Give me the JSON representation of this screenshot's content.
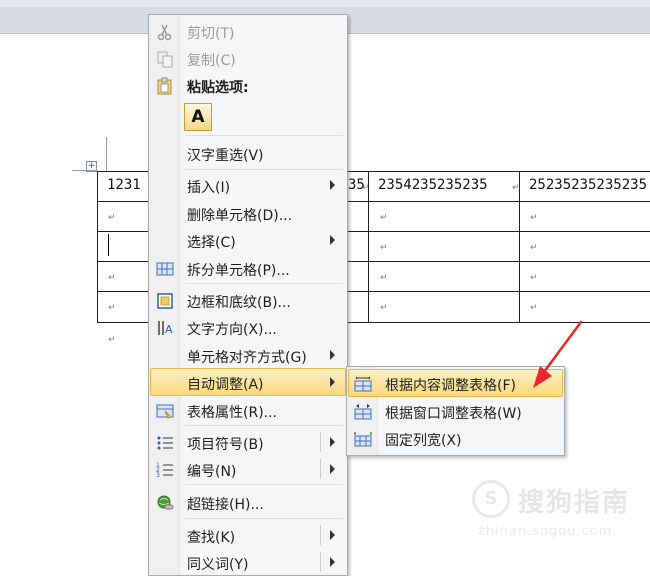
{
  "document": {
    "cells_row1": [
      "1231",
      "35",
      "2354235235235",
      "25235235235235"
    ],
    "para_mark": "↵",
    "move_handle": "+"
  },
  "context_menu": {
    "items": [
      {
        "label": "剪切(T)",
        "icon": "scissors-icon",
        "disabled": true
      },
      {
        "label": "复制(C)",
        "icon": "copy-icon",
        "disabled": true
      },
      {
        "label": "粘贴选项:",
        "icon": "paste-icon",
        "header": true
      },
      {
        "label": "汉字重选(V)"
      },
      {
        "label": "插入(I)",
        "submenu": true
      },
      {
        "label": "删除单元格(D)..."
      },
      {
        "label": "选择(C)",
        "submenu": true
      },
      {
        "label": "拆分单元格(P)...",
        "icon": "split-cells-icon"
      },
      {
        "label": "边框和底纹(B)...",
        "icon": "borders-icon"
      },
      {
        "label": "文字方向(X)...",
        "icon": "text-direction-icon"
      },
      {
        "label": "单元格对齐方式(G)",
        "submenu": true
      },
      {
        "label": "自动调整(A)",
        "submenu": true,
        "highlighted": true
      },
      {
        "label": "表格属性(R)...",
        "icon": "table-properties-icon"
      },
      {
        "label": "项目符号(B)",
        "icon": "bullets-icon",
        "submenu": true
      },
      {
        "label": "编号(N)",
        "icon": "numbering-icon",
        "submenu": true
      },
      {
        "label": "超链接(H)...",
        "icon": "hyperlink-icon"
      },
      {
        "label": "查找(K)",
        "submenu": true
      },
      {
        "label": "同义词(Y)",
        "submenu": true
      }
    ],
    "paste_keep_text": "A"
  },
  "autofit_submenu": {
    "items": [
      {
        "label": "根据内容调整表格(F)",
        "icon": "autofit-contents-icon",
        "highlighted": true
      },
      {
        "label": "根据窗口调整表格(W)",
        "icon": "autofit-window-icon"
      },
      {
        "label": "固定列宽(X)",
        "icon": "fixed-column-width-icon"
      }
    ]
  },
  "watermark": {
    "logo_glyph": "S",
    "text": "搜狗指南",
    "url": "zhinan.sogou.com"
  },
  "colors": {
    "highlight": "#fbd87a",
    "arrow": "#e8282b"
  }
}
